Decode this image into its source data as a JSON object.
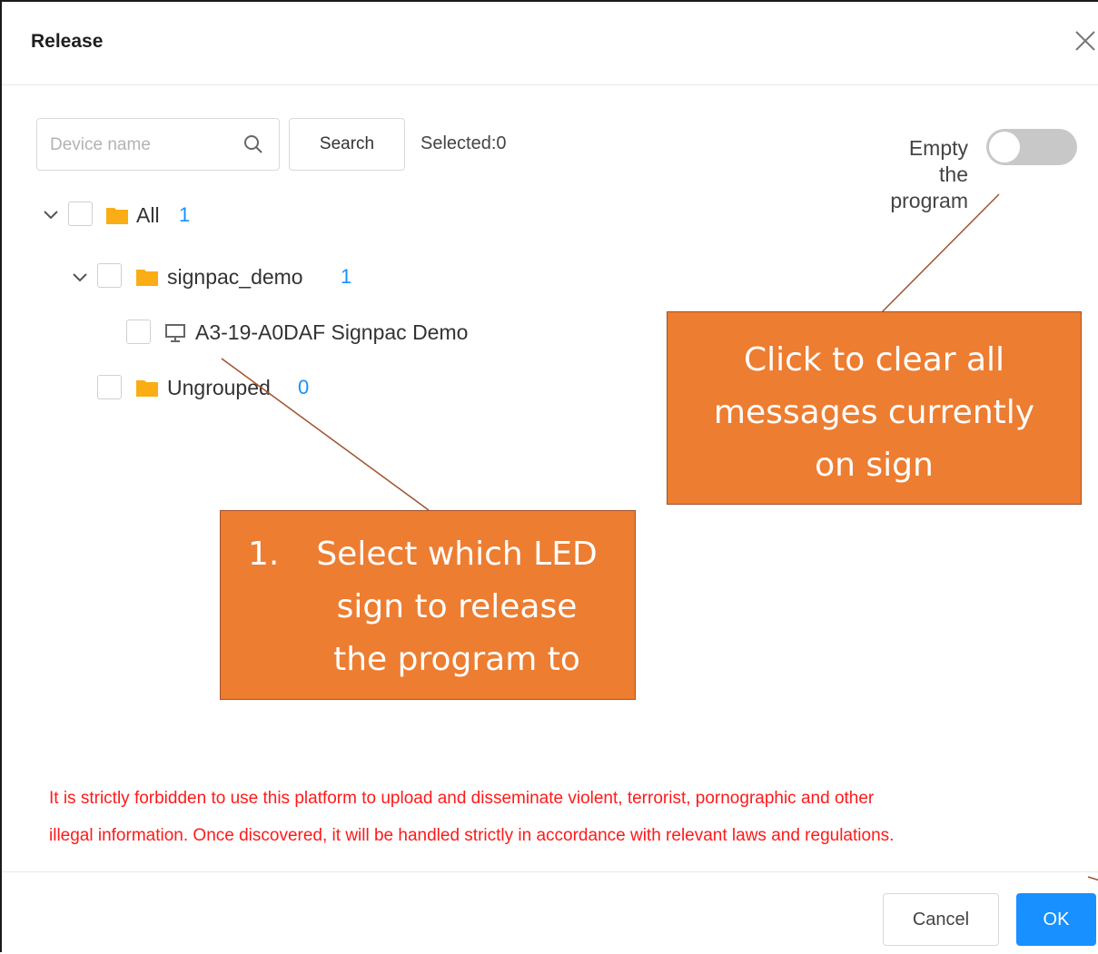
{
  "dialog": {
    "title": "Release"
  },
  "search": {
    "placeholder": "Device name",
    "button_label": "Search",
    "selected_text": "Selected:0"
  },
  "tree": {
    "all": {
      "label": "All",
      "count": "1"
    },
    "group": {
      "label": "signpac_demo",
      "count": "1"
    },
    "device": {
      "label": "A3-19-A0DAF Signpac Demo"
    },
    "ungrouped": {
      "label": "Ungrouped",
      "count": "0"
    }
  },
  "toggle": {
    "label_line1": "Empty",
    "label_line2": "the",
    "label_line3": "program",
    "state": "off"
  },
  "callouts": {
    "clear": {
      "line1": "Click to clear all",
      "line2": "messages currently",
      "line3": "on sign"
    },
    "select": {
      "number": "1.",
      "line1": "Select which LED",
      "line2": "sign to release",
      "line3": "the program to"
    }
  },
  "warning": {
    "line1": "It is strictly forbidden to use this platform to upload and disseminate violent, terrorist, pornographic and other",
    "line2": "illegal information. Once discovered, it will be handled strictly in accordance with relevant laws and regulations."
  },
  "footer": {
    "cancel_label": "Cancel",
    "ok_label": "OK"
  },
  "colors": {
    "accent": "#1890ff",
    "callout": "#ed7d31",
    "warning": "#ff1a1a",
    "folder": "#faad14"
  },
  "icons": {
    "close": "close-icon",
    "search": "search-icon",
    "folder": "folder-icon",
    "device": "monitor-icon",
    "expand": "chevron-down-icon"
  }
}
